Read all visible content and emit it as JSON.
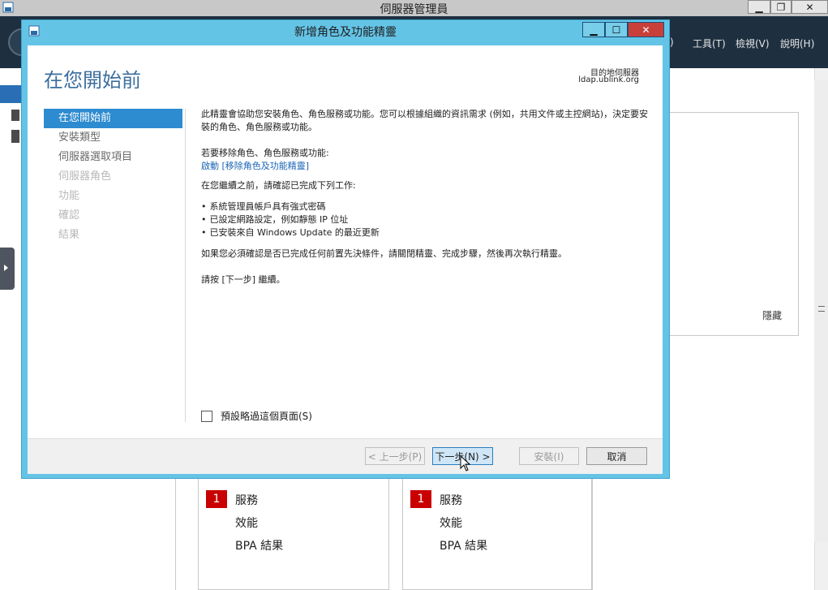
{
  "server_manager": {
    "title": "伺服器管理員",
    "menus": [
      ")",
      "工具(T)",
      "檢視(V)",
      "說明(H)"
    ],
    "hide_label": "隱藏",
    "tiles": [
      {
        "badge": "1",
        "items": [
          "服務",
          "效能",
          "BPA 結果"
        ]
      },
      {
        "badge": "1",
        "items": [
          "服務",
          "效能",
          "BPA 結果"
        ]
      }
    ]
  },
  "wizard": {
    "title": "新增角色及功能精靈",
    "heading": "在您開始前",
    "destination_label": "目的地伺服器",
    "destination_server": "ldap.ublink.org",
    "nav": [
      {
        "label": "在您開始前",
        "state": "active"
      },
      {
        "label": "安裝類型",
        "state": "enabled"
      },
      {
        "label": "伺服器選取項目",
        "state": "enabled"
      },
      {
        "label": "伺服器角色",
        "state": "disabled"
      },
      {
        "label": "功能",
        "state": "disabled"
      },
      {
        "label": "確認",
        "state": "disabled"
      },
      {
        "label": "結果",
        "state": "disabled"
      }
    ],
    "content": {
      "intro": "此精靈會協助您安裝角色、角色服務或功能。您可以根據組織的資訊需求 (例如，共用文件或主控網站)，決定要安裝的角色、角色服務或功能。",
      "remove_prompt": "若要移除角色、角色服務或功能:",
      "remove_link": "啟動 [移除角色及功能精靈]",
      "before_continue": "在您繼續之前，請確認已完成下列工作:",
      "bullets": [
        "系統管理員帳戶具有強式密碼",
        "已設定網路設定，例如靜態 IP 位址",
        "已安裝來自 Windows Update 的最近更新"
      ],
      "if_needed": "如果您必須確認是否已完成任何前置先決條件，請關閉精靈、完成步驟，然後再次執行精靈。",
      "press_next": "請按 [下一步] 繼續。"
    },
    "skip_checkbox": {
      "label": "預設略過這個頁面(S)",
      "checked": false
    },
    "buttons": {
      "prev": "< 上一步(P)",
      "next": "下一步(N) >",
      "install": "安裝(I)",
      "cancel": "取消"
    }
  }
}
